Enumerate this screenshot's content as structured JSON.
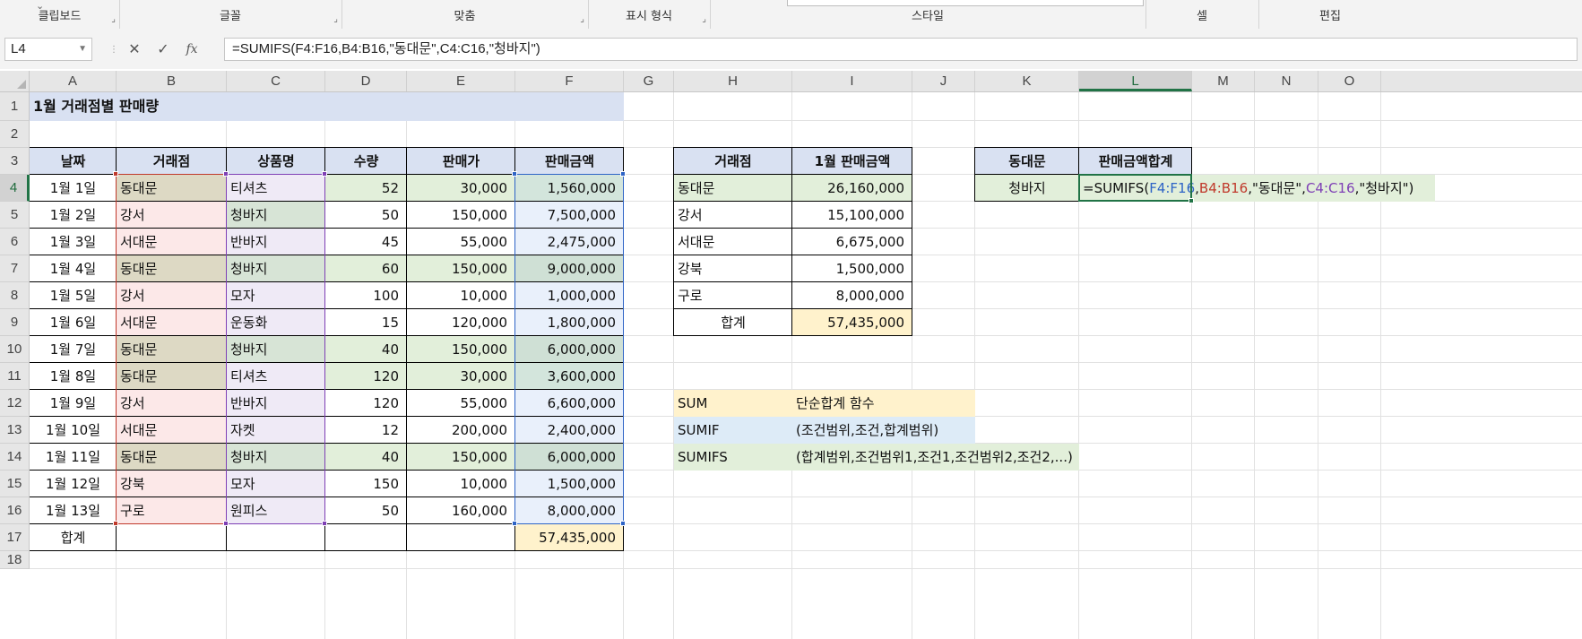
{
  "ribbon": {
    "groups": [
      {
        "label": "클립보드"
      },
      {
        "label": "글꼴"
      },
      {
        "label": "맞춤"
      },
      {
        "label": "표시 형식"
      },
      {
        "label": "스타일"
      },
      {
        "label": "셀"
      },
      {
        "label": "편집"
      }
    ]
  },
  "formula_bar": {
    "name_box": "L4",
    "cancel_icon": "✕",
    "enter_icon": "✓",
    "fx_label": "fx",
    "formula": "=SUMIFS(F4:F16,B4:B16,\"동대문\",C4:C16,\"청바지\")"
  },
  "columns": [
    "A",
    "B",
    "C",
    "D",
    "E",
    "F",
    "G",
    "H",
    "I",
    "J",
    "K",
    "L",
    "M",
    "N",
    "O"
  ],
  "rows": [
    "1",
    "2",
    "3",
    "4",
    "5",
    "6",
    "7",
    "8",
    "9",
    "10",
    "11",
    "12",
    "13",
    "14",
    "15",
    "16",
    "17",
    "18"
  ],
  "selected_cell": {
    "column": "L",
    "row": "4"
  },
  "sheet": {
    "title": "1월 거래점별 판매량",
    "main_table": {
      "headers": [
        "날짜",
        "거래점",
        "상품명",
        "수량",
        "판매가",
        "판매금액"
      ],
      "rows": [
        [
          "1월 1일",
          "동대문",
          "티셔츠",
          "52",
          "30,000",
          "1,560,000"
        ],
        [
          "1월 2일",
          "강서",
          "청바지",
          "50",
          "150,000",
          "7,500,000"
        ],
        [
          "1월 3일",
          "서대문",
          "반바지",
          "45",
          "55,000",
          "2,475,000"
        ],
        [
          "1월 4일",
          "동대문",
          "청바지",
          "60",
          "150,000",
          "9,000,000"
        ],
        [
          "1월 5일",
          "강서",
          "모자",
          "100",
          "10,000",
          "1,000,000"
        ],
        [
          "1월 6일",
          "서대문",
          "운동화",
          "15",
          "120,000",
          "1,800,000"
        ],
        [
          "1월 7일",
          "동대문",
          "청바지",
          "40",
          "150,000",
          "6,000,000"
        ],
        [
          "1월 8일",
          "동대문",
          "티셔츠",
          "120",
          "30,000",
          "3,600,000"
        ],
        [
          "1월 9일",
          "강서",
          "반바지",
          "120",
          "55,000",
          "6,600,000"
        ],
        [
          "1월 10일",
          "서대문",
          "자켓",
          "12",
          "200,000",
          "2,400,000"
        ],
        [
          "1월 11일",
          "동대문",
          "청바지",
          "40",
          "150,000",
          "6,000,000"
        ],
        [
          "1월 12일",
          "강북",
          "모자",
          "150",
          "10,000",
          "1,500,000"
        ],
        [
          "1월 13일",
          "구로",
          "원피스",
          "50",
          "160,000",
          "8,000,000"
        ]
      ],
      "total_label": "합계",
      "total_value": "57,435,000"
    },
    "summary_table": {
      "headers": [
        "거래점",
        "1월 판매금액"
      ],
      "rows": [
        [
          "동대문",
          "26,160,000"
        ],
        [
          "강서",
          "15,100,000"
        ],
        [
          "서대문",
          "6,675,000"
        ],
        [
          "강북",
          "1,500,000"
        ],
        [
          "구로",
          "8,000,000"
        ]
      ],
      "total_label": "합계",
      "total_value": "57,435,000"
    },
    "lookup_table": {
      "header_k": "동대문",
      "header_l": "판매금액합계",
      "k4": "청바지",
      "formula_parts": [
        {
          "text": "=SUMIFS(",
          "color": "#111111"
        },
        {
          "text": "F4:F16",
          "color": "#2e64c6"
        },
        {
          "text": ",",
          "color": "#111111"
        },
        {
          "text": "B4:B16",
          "color": "#c0392b"
        },
        {
          "text": ",\"동대문\",",
          "color": "#111111"
        },
        {
          "text": "C4:C16",
          "color": "#7e3fb5"
        },
        {
          "text": ",\"청바지\")",
          "color": "#111111"
        }
      ]
    },
    "notes": [
      {
        "name": "SUM",
        "desc": "단순합계 함수"
      },
      {
        "name": "SUMIF",
        "desc": "(조건범위,조건,합계범위)"
      },
      {
        "name": "SUMIFS",
        "desc": "(합계범위,조건범위1,조건1,조건범위2,조건2,...)"
      }
    ]
  },
  "colors": {
    "title_fill": "#d9e1f2",
    "header_fill": "#d9e1f2",
    "total_fill": "#fff2cc",
    "green_fill": "#e2efda",
    "range_f": "#2e64c6",
    "range_b": "#c0392b",
    "range_c": "#7e3fb5",
    "selection": "#217346",
    "note_sum": "#fff2cc",
    "note_sumif": "#ddebf7",
    "note_sumifs": "#e2efda"
  }
}
